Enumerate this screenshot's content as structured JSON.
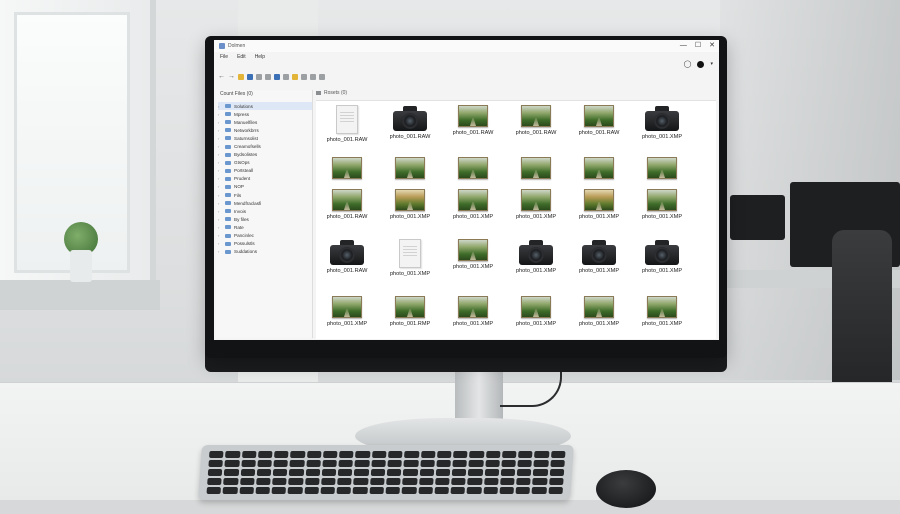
{
  "window": {
    "title": "Dolmen",
    "controls": [
      "—",
      "☐",
      "✕"
    ]
  },
  "menu": [
    "File",
    "Edit",
    "Help"
  ],
  "sidebar": {
    "header": "Count Files (0)",
    "items": [
      "Solutions",
      "Mpress",
      "Manuelfiles",
      "Networkbrrs",
      "Saturnsolist",
      "Creamofsells",
      "Bydsolistes",
      "GtsOps",
      "Portsteall",
      "Prudent",
      "NOP",
      "Fils",
      "Mendfraclasfi",
      "Invois",
      "By files",
      "Rate",
      "Pancinlec",
      "Possulstls",
      "Suddations"
    ]
  },
  "pathbar": {
    "label": "Rosets (0)"
  },
  "files": [
    {
      "name": "photo_001.RAW",
      "kind": "doc"
    },
    {
      "name": "photo_001.RAW",
      "kind": "camera"
    },
    {
      "name": "photo_001.RAW",
      "kind": "landscape"
    },
    {
      "name": "photo_001.RAW",
      "kind": "landscape"
    },
    {
      "name": "photo_001.RAW",
      "kind": "landscape"
    },
    {
      "name": "photo_001.XMP",
      "kind": "camera"
    },
    {
      "name": "",
      "kind": "landscape"
    },
    {
      "name": "",
      "kind": "landscape"
    },
    {
      "name": "",
      "kind": "landscape"
    },
    {
      "name": "",
      "kind": "landscape"
    },
    {
      "name": "",
      "kind": "landscape"
    },
    {
      "name": "",
      "kind": "landscape"
    },
    {
      "name": "photo_001.RAW",
      "kind": "landscape"
    },
    {
      "name": "photo_001.XMP",
      "kind": "landscape-warm"
    },
    {
      "name": "photo_001.XMP",
      "kind": "landscape"
    },
    {
      "name": "photo_001.XMP",
      "kind": "landscape"
    },
    {
      "name": "photo_001.XMP",
      "kind": "landscape-warm"
    },
    {
      "name": "photo_001.XMP",
      "kind": "landscape"
    },
    {
      "name": "photo_001.RAW",
      "kind": "camera"
    },
    {
      "name": "photo_001.XMP",
      "kind": "doc"
    },
    {
      "name": "photo_001.XMP",
      "kind": "landscape"
    },
    {
      "name": "photo_001.XMP",
      "kind": "camera"
    },
    {
      "name": "photo_001.XMP",
      "kind": "camera"
    },
    {
      "name": "photo_001.XMP",
      "kind": "camera"
    },
    {
      "name": "photo_001.XMP",
      "kind": "landscape"
    },
    {
      "name": "photo_001.RMP",
      "kind": "landscape"
    },
    {
      "name": "photo_001.XMP",
      "kind": "landscape"
    },
    {
      "name": "photo_001.XMP",
      "kind": "landscape"
    },
    {
      "name": "photo_001.XMP",
      "kind": "landscape"
    },
    {
      "name": "photo_001.XMP",
      "kind": "landscape"
    }
  ],
  "icons": {
    "toolbar": [
      "back-arrow-icon",
      "forward-arrow-icon",
      "new-folder-icon",
      "view-icon",
      "list-icon",
      "grid-icon",
      "share-icon",
      "search-icon",
      "tag-icon",
      "settings-icon"
    ],
    "account": [
      "user-icon",
      "avatar-icon"
    ]
  },
  "colors": {
    "accent": "#3b6fb6",
    "selection": "#dde7f5",
    "folder": "#6b97cf"
  }
}
